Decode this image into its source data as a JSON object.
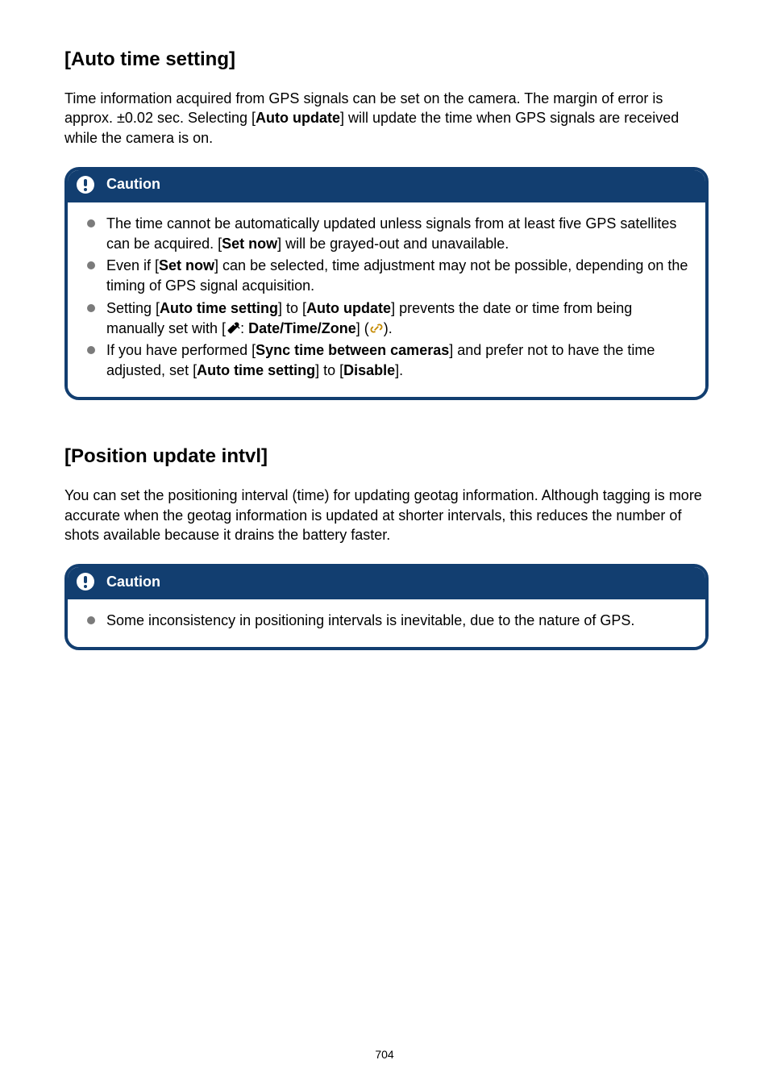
{
  "section1": {
    "heading": "[Auto time setting]",
    "intro_part1": "Time information acquired from GPS signals can be set on the camera. The margin of error is approx. ±0.02 sec. Selecting [",
    "intro_bold1": "Auto update",
    "intro_part2": "] will update the time when GPS signals are received while the camera is on.",
    "caution_label": "Caution",
    "bullets": {
      "b1_p1": "The time cannot be automatically updated unless signals from at least five GPS satellites can be acquired. [",
      "b1_bold1": "Set now",
      "b1_p2": "] will be grayed-out and unavailable.",
      "b2_p1": "Even if [",
      "b2_bold1": "Set now",
      "b2_p2": "] can be selected, time adjustment may not be possible, depending on the timing of GPS signal acquisition.",
      "b3_p1": "Setting [",
      "b3_bold1": "Auto time setting",
      "b3_p2": "] to [",
      "b3_bold2": "Auto update",
      "b3_p3": "] prevents the date or time from being manually set with [",
      "b3_bold3": "Date/Time/Zone",
      "b3_p4": "] (",
      "b3_p5": ").",
      "b4_p1": "If you have performed [",
      "b4_bold1": "Sync time between cameras",
      "b4_p2": "] and prefer not to have the time adjusted, set [",
      "b4_bold2": "Auto time setting",
      "b4_p3": "] to [",
      "b4_bold3": "Disable",
      "b4_p4": "]."
    }
  },
  "section2": {
    "heading": "[Position update intvl]",
    "intro": "You can set the positioning interval (time) for updating geotag information. Although tagging is more accurate when the geotag information is updated at shorter intervals, this reduces the number of shots available because it drains the battery faster.",
    "caution_label": "Caution",
    "bullet": "Some inconsistency in positioning intervals is inevitable, due to the nature of GPS."
  },
  "page_number": "704"
}
